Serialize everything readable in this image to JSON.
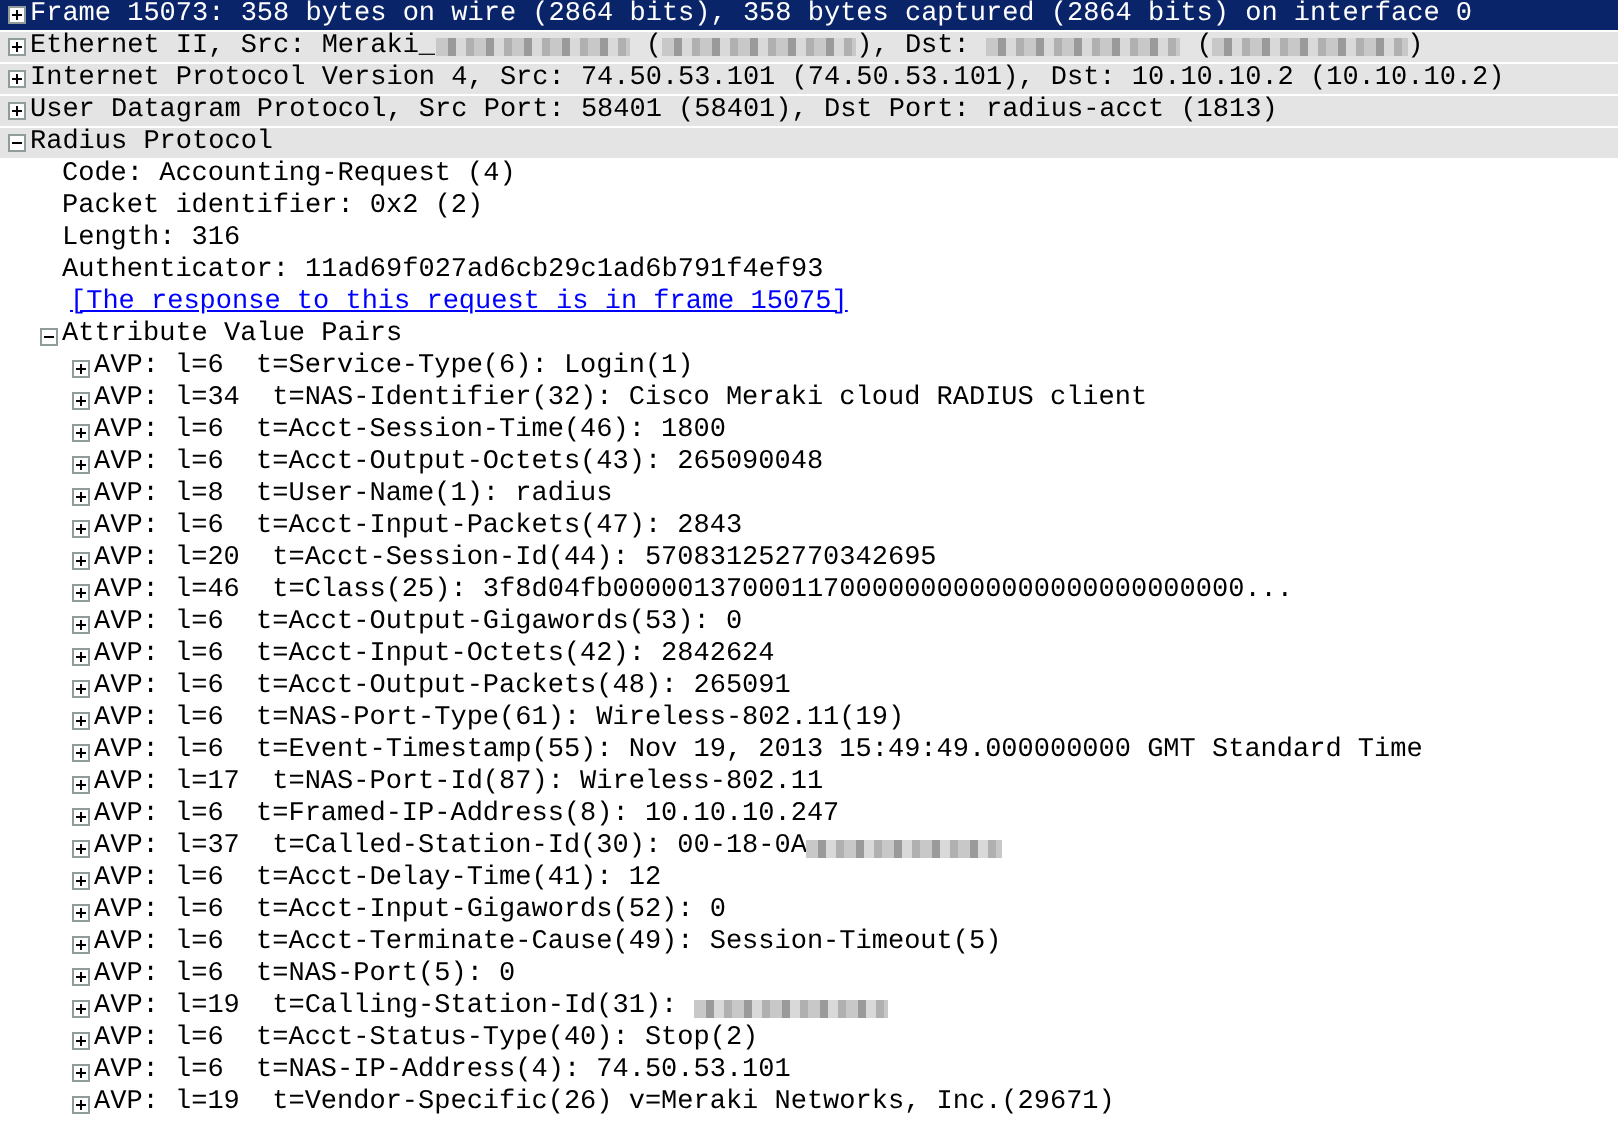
{
  "tree": [
    {
      "kind": "branch",
      "expanded": false,
      "selected": true,
      "text": "Frame 15073: 358 bytes on wire (2864 bits), 358 bytes captured (2864 bits) on interface 0"
    },
    {
      "kind": "branch",
      "expanded": false,
      "selected": false,
      "segments": [
        {
          "kind": "text",
          "text": "Ethernet II, Src: Meraki_"
        },
        {
          "kind": "redacted"
        },
        {
          "kind": "text",
          "text": " ("
        },
        {
          "kind": "redacted"
        },
        {
          "kind": "text",
          "text": "), Dst: "
        },
        {
          "kind": "redacted"
        },
        {
          "kind": "text",
          "text": " ("
        },
        {
          "kind": "redacted"
        },
        {
          "kind": "text",
          "text": ")"
        }
      ]
    },
    {
      "kind": "branch",
      "expanded": false,
      "selected": false,
      "text": "Internet Protocol Version 4, Src: 74.50.53.101 (74.50.53.101), Dst: 10.10.10.2 (10.10.10.2)"
    },
    {
      "kind": "branch",
      "expanded": false,
      "selected": false,
      "text": "User Datagram Protocol, Src Port: 58401 (58401), Dst Port: radius-acct (1813)"
    },
    {
      "kind": "branch",
      "expanded": true,
      "selected": false,
      "text": "Radius Protocol",
      "children": [
        {
          "kind": "field",
          "selected": false,
          "text": "Code: Accounting-Request (4)"
        },
        {
          "kind": "field",
          "selected": false,
          "text": "Packet identifier: 0x2 (2)"
        },
        {
          "kind": "field",
          "selected": false,
          "text": "Length: 316"
        },
        {
          "kind": "field",
          "selected": false,
          "text": "Authenticator: 11ad69f027ad6cb29c1ad6b791f4ef93"
        },
        {
          "kind": "link",
          "selected": false,
          "text": "[The response to this request is in frame 15075]"
        },
        {
          "kind": "branch",
          "expanded": true,
          "selected": false,
          "text": "Attribute Value Pairs",
          "children": [
            {
              "kind": "branch",
              "expanded": false,
              "selected": false,
              "text": "AVP: l=6  t=Service-Type(6): Login(1)"
            },
            {
              "kind": "branch",
              "expanded": false,
              "selected": false,
              "text": "AVP: l=34  t=NAS-Identifier(32): Cisco Meraki cloud RADIUS client"
            },
            {
              "kind": "branch",
              "expanded": false,
              "selected": false,
              "text": "AVP: l=6  t=Acct-Session-Time(46): 1800"
            },
            {
              "kind": "branch",
              "expanded": false,
              "selected": false,
              "text": "AVP: l=6  t=Acct-Output-Octets(43): 265090048"
            },
            {
              "kind": "branch",
              "expanded": false,
              "selected": false,
              "text": "AVP: l=8  t=User-Name(1): radius"
            },
            {
              "kind": "branch",
              "expanded": false,
              "selected": false,
              "text": "AVP: l=6  t=Acct-Input-Packets(47): 2843"
            },
            {
              "kind": "branch",
              "expanded": false,
              "selected": false,
              "text": "AVP: l=20  t=Acct-Session-Id(44): 570831252770342695"
            },
            {
              "kind": "branch",
              "expanded": false,
              "selected": false,
              "text": "AVP: l=46  t=Class(25): 3f8d04fb000001370001170000000000000000000000000..."
            },
            {
              "kind": "branch",
              "expanded": false,
              "selected": false,
              "text": "AVP: l=6  t=Acct-Output-Gigawords(53): 0"
            },
            {
              "kind": "branch",
              "expanded": false,
              "selected": false,
              "text": "AVP: l=6  t=Acct-Input-Octets(42): 2842624"
            },
            {
              "kind": "branch",
              "expanded": false,
              "selected": false,
              "text": "AVP: l=6  t=Acct-Output-Packets(48): 265091"
            },
            {
              "kind": "branch",
              "expanded": false,
              "selected": false,
              "text": "AVP: l=6  t=NAS-Port-Type(61): Wireless-802.11(19)"
            },
            {
              "kind": "branch",
              "expanded": false,
              "selected": false,
              "text": "AVP: l=6  t=Event-Timestamp(55): Nov 19, 2013 15:49:49.000000000 GMT Standard Time"
            },
            {
              "kind": "branch",
              "expanded": false,
              "selected": false,
              "text": "AVP: l=17  t=NAS-Port-Id(87): Wireless-802.11"
            },
            {
              "kind": "branch",
              "expanded": false,
              "selected": false,
              "text": "AVP: l=6  t=Framed-IP-Address(8): 10.10.10.247"
            },
            {
              "kind": "branch",
              "expanded": false,
              "selected": false,
              "segments": [
                {
                  "kind": "text",
                  "text": "AVP: l=37  t=Called-Station-Id(30): 00-18-0A"
                },
                {
                  "kind": "redacted"
                }
              ]
            },
            {
              "kind": "branch",
              "expanded": false,
              "selected": false,
              "text": "AVP: l=6  t=Acct-Delay-Time(41): 12"
            },
            {
              "kind": "branch",
              "expanded": false,
              "selected": false,
              "text": "AVP: l=6  t=Acct-Input-Gigawords(52): 0"
            },
            {
              "kind": "branch",
              "expanded": false,
              "selected": false,
              "text": "AVP: l=6  t=Acct-Terminate-Cause(49): Session-Timeout(5)"
            },
            {
              "kind": "branch",
              "expanded": false,
              "selected": false,
              "text": "AVP: l=6  t=NAS-Port(5): 0"
            },
            {
              "kind": "branch",
              "expanded": false,
              "selected": false,
              "segments": [
                {
                  "kind": "text",
                  "text": "AVP: l=19  t=Calling-Station-Id(31): "
                },
                {
                  "kind": "redacted"
                }
              ]
            },
            {
              "kind": "branch",
              "expanded": false,
              "selected": false,
              "text": "AVP: l=6  t=Acct-Status-Type(40): Stop(2)"
            },
            {
              "kind": "branch",
              "expanded": false,
              "selected": false,
              "text": "AVP: l=6  t=NAS-IP-Address(4): 74.50.53.101"
            },
            {
              "kind": "branch",
              "expanded": false,
              "selected": false,
              "text": "AVP: l=19  t=Vendor-Specific(26) v=Meraki Networks, Inc.(29671)"
            }
          ]
        }
      ]
    }
  ]
}
